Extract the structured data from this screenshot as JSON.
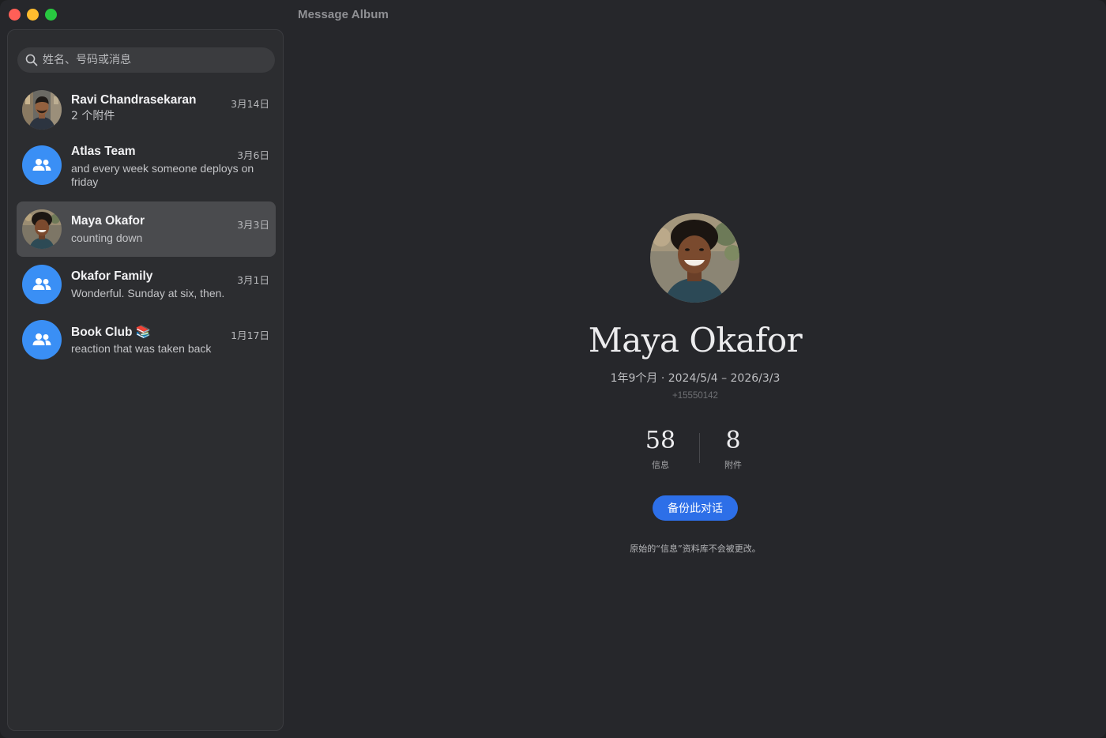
{
  "window": {
    "title": "Message Album"
  },
  "search": {
    "placeholder": "姓名、号码或消息"
  },
  "conversations": [
    {
      "name": "Ravi Chandrasekaran",
      "date": "3月14日",
      "preview": "2 个附件",
      "avatar": "photo",
      "selected": false
    },
    {
      "name": "Atlas Team",
      "date": "3月6日",
      "preview": "and every week someone deploys on friday",
      "avatar": "group-icon",
      "selected": false
    },
    {
      "name": "Maya Okafor",
      "date": "3月3日",
      "preview": "counting down",
      "avatar": "photo",
      "selected": true
    },
    {
      "name": "Okafor Family",
      "date": "3月1日",
      "preview": "Wonderful. Sunday at six, then.",
      "avatar": "group-icon",
      "selected": false
    },
    {
      "name": "Book Club 📚",
      "date": "1月17日",
      "preview": "reaction that was taken back",
      "avatar": "group-icon",
      "selected": false
    }
  ],
  "profile": {
    "name": "Maya Okafor",
    "range": "1年9个月 · 2024/5/4 – 2026/3/3",
    "phone": "+15550142",
    "stats": [
      {
        "value": "58",
        "label": "信息"
      },
      {
        "value": "8",
        "label": "附件"
      }
    ],
    "backup_label": "备份此对话",
    "footnote": "原始的“信息”资料库不会被更改。"
  },
  "colors": {
    "accent": "#2d6fe8",
    "group_avatar": "#3a8ff5",
    "window_bg": "#26272b",
    "sidebar_bg": "#2c2d30",
    "selected_row": "#4a4b4e"
  }
}
